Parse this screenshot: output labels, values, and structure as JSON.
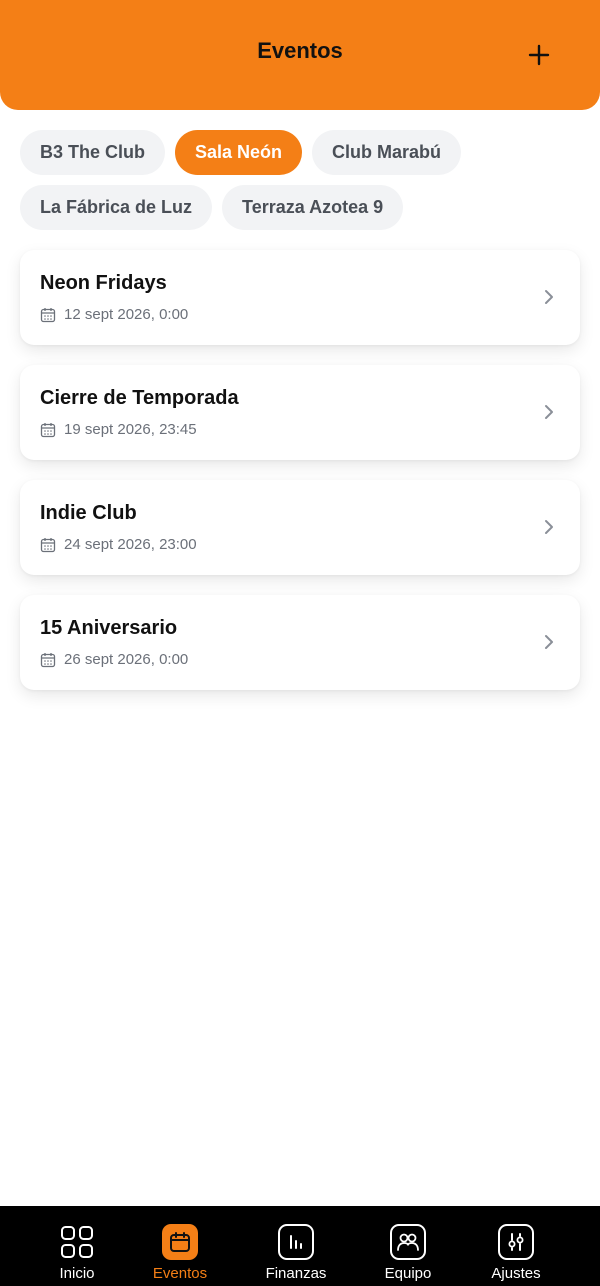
{
  "header": {
    "title": "Eventos"
  },
  "venues": {
    "row1": [
      {
        "label": "B3 The Club",
        "active": false
      },
      {
        "label": "Sala Neón",
        "active": true
      },
      {
        "label": "Club Marabú",
        "active": false
      }
    ],
    "row2": [
      {
        "label": "La Fábrica de Luz",
        "active": false
      },
      {
        "label": "Terraza Azotea 9",
        "active": false
      }
    ]
  },
  "events": [
    {
      "title": "Neon Fridays",
      "date": "12 sept 2026, 0:00"
    },
    {
      "title": "Cierre de Temporada",
      "date": "19 sept 2026, 23:45"
    },
    {
      "title": "Indie Club",
      "date": "24 sept 2026, 23:00"
    },
    {
      "title": "15 Aniversario",
      "date": "26 sept 2026, 0:00"
    }
  ],
  "nav": [
    {
      "label": "Inicio",
      "icon": "grid-icon",
      "active": false
    },
    {
      "label": "Eventos",
      "icon": "calendar-icon",
      "active": true
    },
    {
      "label": "Finanzas",
      "icon": "bar-chart-icon",
      "active": false
    },
    {
      "label": "Equipo",
      "icon": "team-icon",
      "active": false
    },
    {
      "label": "Ajustes",
      "icon": "sliders-icon",
      "active": false
    }
  ],
  "colors": {
    "accent": "#f47f16",
    "chip_bg": "#f2f3f5",
    "nav_bg": "#000000"
  }
}
